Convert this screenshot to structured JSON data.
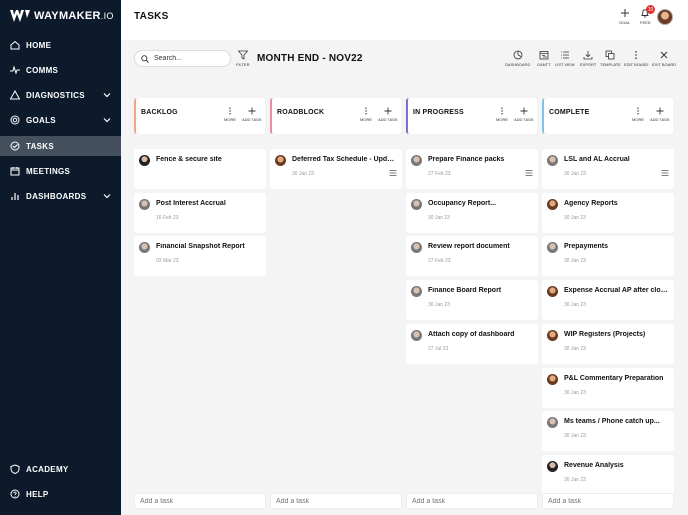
{
  "brand": {
    "name": "WAYMAKER",
    "suffix": ".IO"
  },
  "sidebar": {
    "items": [
      {
        "label": "HOME",
        "icon": "home-icon"
      },
      {
        "label": "COMMS",
        "icon": "pulse-icon"
      },
      {
        "label": "DIAGNOSTICS",
        "icon": "warning-icon",
        "expandable": true
      },
      {
        "label": "GOALS",
        "icon": "target-icon",
        "expandable": true
      },
      {
        "label": "TASKS",
        "icon": "check-circle-icon",
        "active": true
      },
      {
        "label": "MEETINGS",
        "icon": "calendar-icon"
      },
      {
        "label": "DASHBOARDS",
        "icon": "bar-chart-icon",
        "expandable": true
      }
    ],
    "footer": [
      {
        "label": "ACADEMY",
        "icon": "shield-icon"
      },
      {
        "label": "HELP",
        "icon": "help-icon"
      }
    ]
  },
  "header": {
    "title": "TASKS",
    "goal_label": "GOAL",
    "feed_label": "FEED",
    "feed_badge": "10"
  },
  "toolbar": {
    "search_placeholder": "Search...",
    "filter_label": "FILTER",
    "board_title": "MONTH END - NOV22",
    "tools": [
      "DASHBOARD",
      "GANTT",
      "LIST VIEW",
      "EXPORT",
      "TEMPLATE",
      "EDIT BOARD",
      "EXIT BOARD"
    ]
  },
  "column_actions": {
    "more": "MORE",
    "add": "ADD TASK"
  },
  "columns": [
    {
      "title": "BACKLOG",
      "color": "#f0a58a",
      "cards": [
        {
          "title": "Fence & secure site",
          "date": "",
          "avatar": "dark",
          "list": false
        },
        {
          "title": "Post Interest Accrual",
          "date": "16 Feb 23",
          "avatar": "grey",
          "list": false
        },
        {
          "title": "Financial Snapshot Report",
          "date": "03 Mar 23",
          "avatar": "grey",
          "list": false
        }
      ]
    },
    {
      "title": "ROADBLOCK",
      "color": "#f08aa0",
      "cards": [
        {
          "title": "Deferred Tax Schedule - Update...",
          "date": "30 Jan 23",
          "avatar": "brown",
          "list": true
        }
      ]
    },
    {
      "title": "IN PROGRESS",
      "color": "#7c6fd6",
      "cards": [
        {
          "title": "Prepare Finance packs",
          "date": "27 Feb 23",
          "avatar": "grey",
          "list": true
        },
        {
          "title": "Occupancy Report...",
          "date": "30 Jan 23",
          "avatar": "grey",
          "list": false
        },
        {
          "title": "Review report document",
          "date": "27 Feb 23",
          "avatar": "grey",
          "list": false
        },
        {
          "title": "Finance Board Report",
          "date": "30 Jan 23",
          "avatar": "grey",
          "list": false
        },
        {
          "title": "Attach copy of dashboard",
          "date": "27 Jul 23",
          "avatar": "grey",
          "list": false
        }
      ]
    },
    {
      "title": "COMPLETE",
      "color": "#7cc4e8",
      "cards": [
        {
          "title": "LSL and AL Accrual",
          "date": "30 Jan 23",
          "avatar": "grey",
          "list": true
        },
        {
          "title": "Agency Reports",
          "date": "30 Jan 23",
          "avatar": "brown",
          "list": false
        },
        {
          "title": "Prepayments",
          "date": "30 Jan 23",
          "avatar": "grey",
          "list": false
        },
        {
          "title": "Expense Accrual AP after close...",
          "date": "30 Jan 23",
          "avatar": "brown",
          "list": false
        },
        {
          "title": "WIP Registers (Projects)",
          "date": "30 Jan 23",
          "avatar": "brown",
          "list": false
        },
        {
          "title": "P&L Commentary Preparation",
          "date": "30 Jan 23",
          "avatar": "brown",
          "list": false
        },
        {
          "title": "Ms teams / Phone catch up...",
          "date": "30 Jan 23",
          "avatar": "grey",
          "list": false
        },
        {
          "title": "Revenue Analysis",
          "date": "30 Jan 23",
          "avatar": "dark",
          "list": false
        }
      ]
    }
  ],
  "add_task_placeholder": "Add a task"
}
